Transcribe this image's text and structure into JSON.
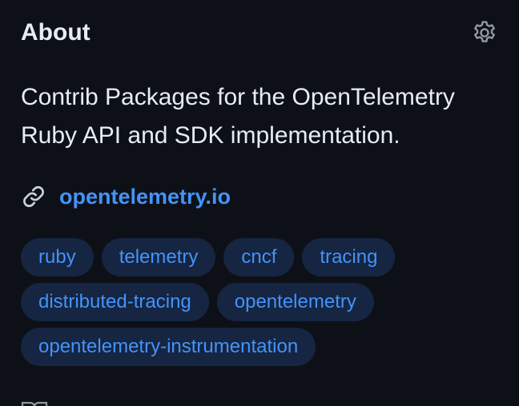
{
  "about": {
    "title": "About",
    "settings_icon": "gear-icon",
    "description_line1": "Contrib Packages for the OpenTelemetry",
    "description_line2": "Ruby API and SDK implementation.",
    "homepage": {
      "icon": "link-icon",
      "label": "opentelemetry.io"
    },
    "topics": [
      "ruby",
      "telemetry",
      "cncf",
      "tracing",
      "distributed-tracing",
      "opentelemetry",
      "opentelemetry-instrumentation"
    ],
    "next_item_icon": "book-icon"
  },
  "colors": {
    "background": "#0d1117",
    "text": "#e6edf3",
    "accent": "#4493f8",
    "topic_bg": "#152542",
    "muted_icon": "#9198a1"
  }
}
